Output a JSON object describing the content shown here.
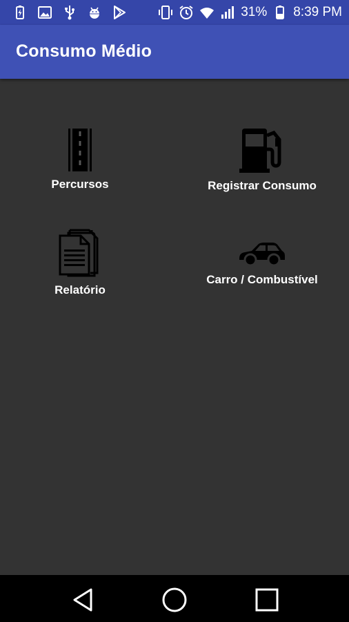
{
  "status_bar": {
    "battery_percent": "31%",
    "time": "8:39 PM",
    "left_icons": [
      "battery-charging-icon",
      "image-icon",
      "usb-icon",
      "android-debug-icon",
      "play-store-icon"
    ],
    "right_icons": [
      "vibrate-icon",
      "alarm-icon",
      "wifi-icon",
      "signal-icon",
      "battery-icon"
    ]
  },
  "app_bar": {
    "title": "Consumo Médio"
  },
  "menu": {
    "items": [
      {
        "label": "Percursos",
        "icon": "road-icon"
      },
      {
        "label": "Registrar Consumo",
        "icon": "fuel-pump-icon"
      },
      {
        "label": "Relatório",
        "icon": "report-document-icon"
      },
      {
        "label": "Carro / Combustível",
        "icon": "car-icon"
      }
    ]
  },
  "nav_bar": {
    "buttons": [
      "back-icon",
      "home-icon",
      "recents-icon"
    ]
  },
  "colors": {
    "status_bar": "#3546a9",
    "app_bar": "#3f51b5",
    "background": "#333333",
    "nav_bar": "#000000"
  }
}
